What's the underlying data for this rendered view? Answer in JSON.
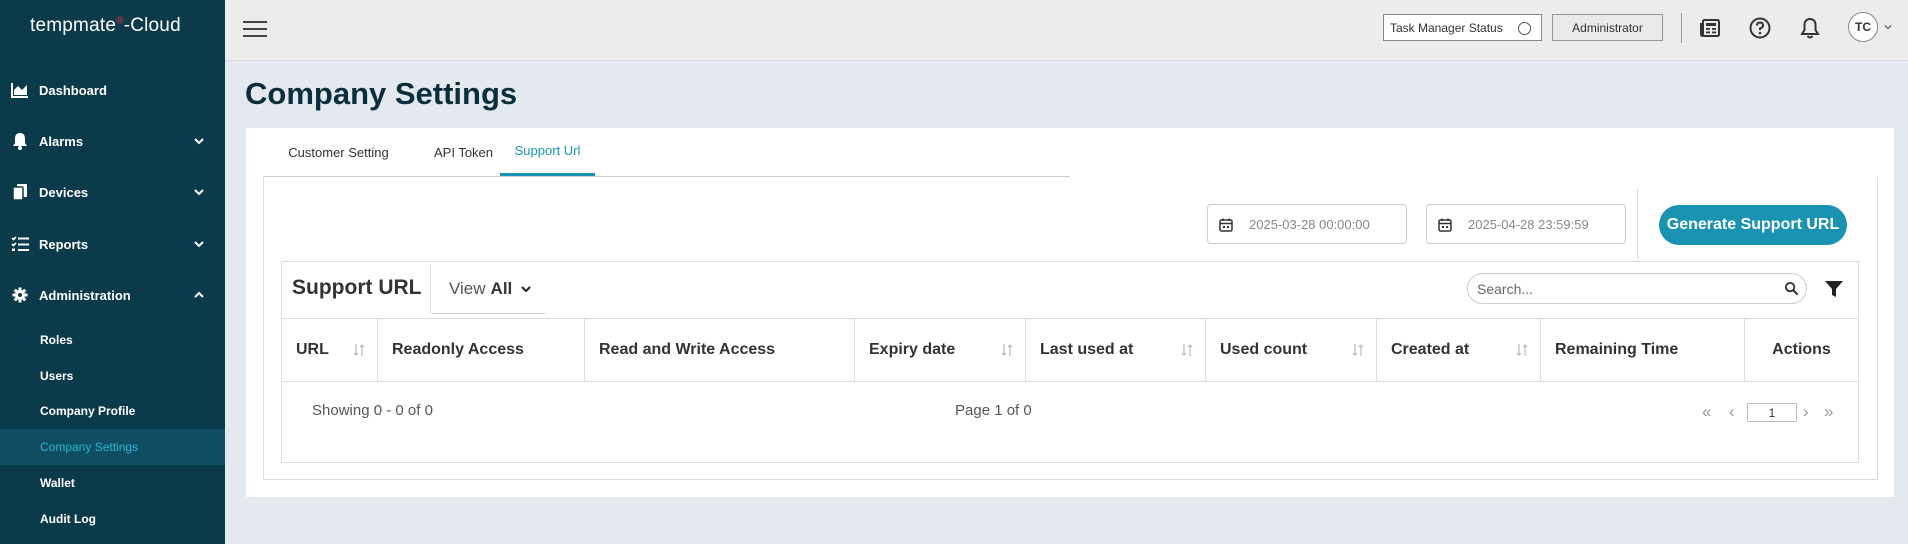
{
  "app": {
    "logo_text": "tempmate",
    "logo_suffix": "-Cloud",
    "logo_mark": "®"
  },
  "sidebar": {
    "items": [
      {
        "label": "Dashboard",
        "icon": "chart-area-icon"
      },
      {
        "label": "Alarms",
        "icon": "bell-icon"
      },
      {
        "label": "Devices",
        "icon": "devices-icon"
      },
      {
        "label": "Reports",
        "icon": "list-check-icon"
      },
      {
        "label": "Administration",
        "icon": "gear-icon"
      }
    ],
    "sub_items": [
      "Roles",
      "Users",
      "Company Profile",
      "Company Settings",
      "Wallet",
      "Audit Log"
    ],
    "active_sub": "Company Settings"
  },
  "topbar": {
    "task_manager_status": "Task Manager Status",
    "role_button": "Administrator",
    "avatar_initials": "TC"
  },
  "page": {
    "title": "Company Settings"
  },
  "tabs": [
    {
      "label": "Customer Setting"
    },
    {
      "label": "API Token"
    },
    {
      "label": "Support Url",
      "active": true
    }
  ],
  "filters": {
    "start_date": "2025-03-28 00:00:00",
    "end_date": "2025-04-28 23:59:59",
    "generate_button": "Generate Support URL"
  },
  "list": {
    "title": "Support URL",
    "view_label": "View",
    "view_value": "All",
    "search_placeholder": "Search...",
    "columns": [
      "URL",
      "Readonly Access",
      "Read and Write Access",
      "Expiry date",
      "Last used at",
      "Used count",
      "Created at",
      "Remaining Time",
      "Actions"
    ],
    "showing": "Showing 0 - 0 of 0",
    "page_info": "Page 1 of 0",
    "current_page": "1"
  },
  "colors": {
    "sidebar": "#0b3a4b",
    "accent": "#1a93b3",
    "title": "#0b2e3d"
  }
}
